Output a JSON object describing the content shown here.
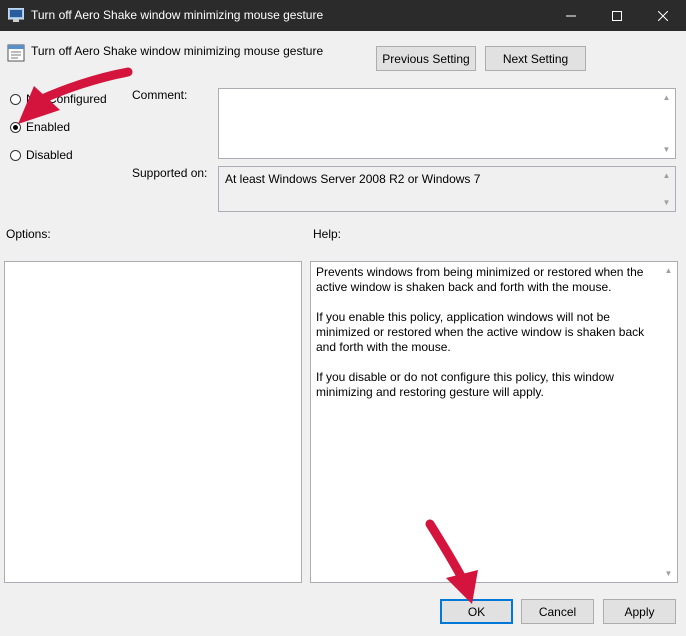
{
  "window": {
    "title": "Turn off Aero Shake window minimizing mouse gesture",
    "controls": {
      "minimize": "minimize",
      "maximize": "maximize",
      "close": "close"
    }
  },
  "header": {
    "policy_name": "Turn off Aero Shake window minimizing mouse gesture",
    "previous_label": "Previous Setting",
    "next_label": "Next Setting"
  },
  "state": {
    "options": [
      {
        "label": "Not Configured",
        "checked": false
      },
      {
        "label": "Enabled",
        "checked": true
      },
      {
        "label": "Disabled",
        "checked": false
      }
    ]
  },
  "fields": {
    "comment_label": "Comment:",
    "comment_value": "",
    "supported_label": "Supported on:",
    "supported_value": "At least Windows Server 2008 R2 or Windows 7"
  },
  "sections": {
    "options_label": "Options:",
    "help_label": "Help:"
  },
  "help": {
    "paragraphs": [
      "Prevents windows from being minimized or restored when the active window is shaken back and forth with the mouse.",
      "If you enable this policy, application windows will not be minimized or restored when the active window is shaken back and forth with the mouse.",
      "If you disable or do not configure this policy, this window minimizing and restoring gesture will apply."
    ]
  },
  "footer": {
    "ok_label": "OK",
    "cancel_label": "Cancel",
    "apply_label": "Apply"
  },
  "colors": {
    "titlebar": "#2b2b2b",
    "annotation_arrow": "#d4143c",
    "default_button_border": "#0078d7"
  }
}
